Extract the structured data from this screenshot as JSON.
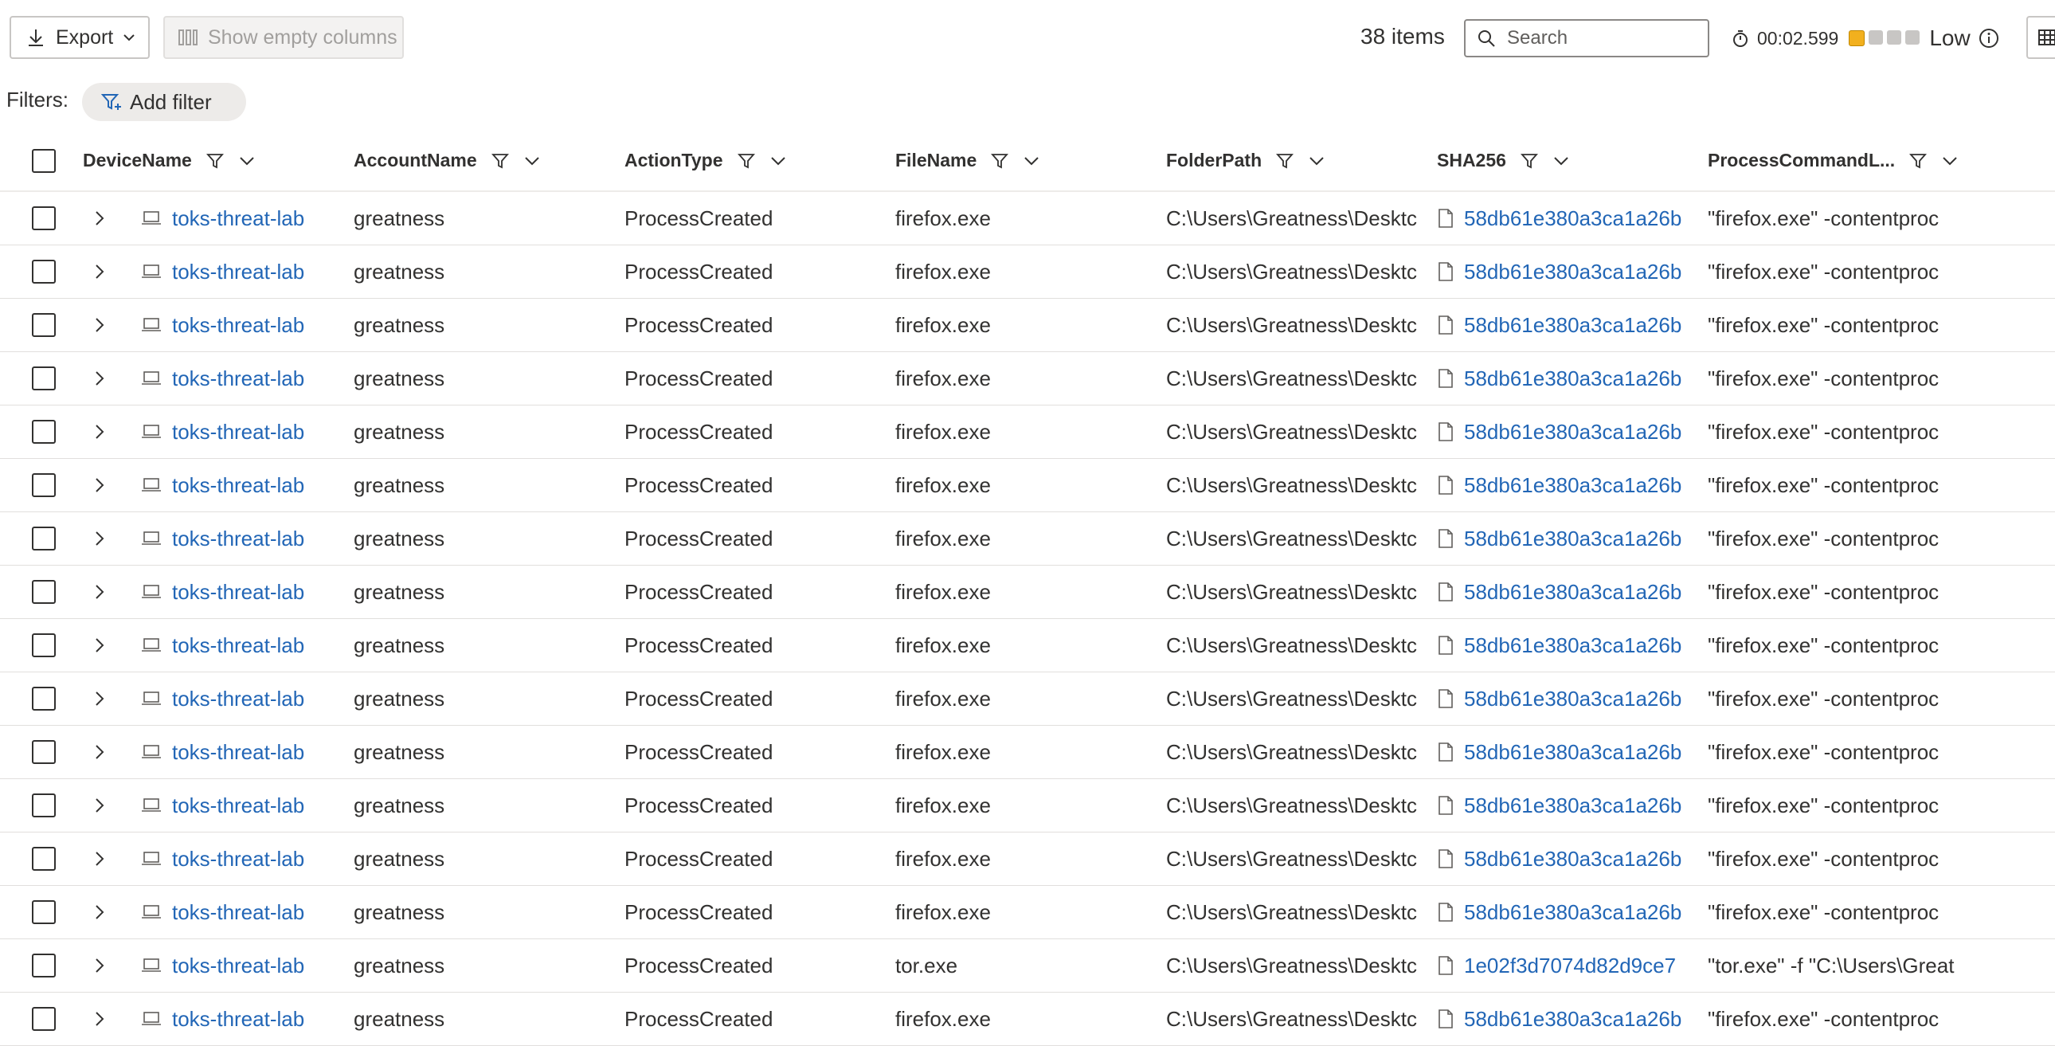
{
  "toolbar": {
    "export_label": "Export",
    "show_empty_label": "Show empty columns",
    "items_count": "38 items",
    "search_placeholder": "Search",
    "timer": "00:02.599",
    "level": "Low",
    "level_colors": [
      "#f2b01e",
      "#c8c6c4",
      "#c8c6c4",
      "#c8c6c4"
    ]
  },
  "filters": {
    "label": "Filters:",
    "add_filter_label": "Add filter"
  },
  "columns": [
    "DeviceName",
    "AccountName",
    "ActionType",
    "FileName",
    "FolderPath",
    "SHA256",
    "ProcessCommandL..."
  ],
  "rows": [
    {
      "device": "toks-threat-lab",
      "account": "greatness",
      "action": "ProcessCreated",
      "file": "firefox.exe",
      "folder": "C:\\Users\\Greatness\\Desktc",
      "sha": "58db61e380a3ca1a26b",
      "cmd": "\"firefox.exe\" -contentproc"
    },
    {
      "device": "toks-threat-lab",
      "account": "greatness",
      "action": "ProcessCreated",
      "file": "firefox.exe",
      "folder": "C:\\Users\\Greatness\\Desktc",
      "sha": "58db61e380a3ca1a26b",
      "cmd": "\"firefox.exe\" -contentproc"
    },
    {
      "device": "toks-threat-lab",
      "account": "greatness",
      "action": "ProcessCreated",
      "file": "firefox.exe",
      "folder": "C:\\Users\\Greatness\\Desktc",
      "sha": "58db61e380a3ca1a26b",
      "cmd": "\"firefox.exe\" -contentproc"
    },
    {
      "device": "toks-threat-lab",
      "account": "greatness",
      "action": "ProcessCreated",
      "file": "firefox.exe",
      "folder": "C:\\Users\\Greatness\\Desktc",
      "sha": "58db61e380a3ca1a26b",
      "cmd": "\"firefox.exe\" -contentproc"
    },
    {
      "device": "toks-threat-lab",
      "account": "greatness",
      "action": "ProcessCreated",
      "file": "firefox.exe",
      "folder": "C:\\Users\\Greatness\\Desktc",
      "sha": "58db61e380a3ca1a26b",
      "cmd": "\"firefox.exe\" -contentproc"
    },
    {
      "device": "toks-threat-lab",
      "account": "greatness",
      "action": "ProcessCreated",
      "file": "firefox.exe",
      "folder": "C:\\Users\\Greatness\\Desktc",
      "sha": "58db61e380a3ca1a26b",
      "cmd": "\"firefox.exe\" -contentproc"
    },
    {
      "device": "toks-threat-lab",
      "account": "greatness",
      "action": "ProcessCreated",
      "file": "firefox.exe",
      "folder": "C:\\Users\\Greatness\\Desktc",
      "sha": "58db61e380a3ca1a26b",
      "cmd": "\"firefox.exe\" -contentproc"
    },
    {
      "device": "toks-threat-lab",
      "account": "greatness",
      "action": "ProcessCreated",
      "file": "firefox.exe",
      "folder": "C:\\Users\\Greatness\\Desktc",
      "sha": "58db61e380a3ca1a26b",
      "cmd": "\"firefox.exe\" -contentproc"
    },
    {
      "device": "toks-threat-lab",
      "account": "greatness",
      "action": "ProcessCreated",
      "file": "firefox.exe",
      "folder": "C:\\Users\\Greatness\\Desktc",
      "sha": "58db61e380a3ca1a26b",
      "cmd": "\"firefox.exe\" -contentproc"
    },
    {
      "device": "toks-threat-lab",
      "account": "greatness",
      "action": "ProcessCreated",
      "file": "firefox.exe",
      "folder": "C:\\Users\\Greatness\\Desktc",
      "sha": "58db61e380a3ca1a26b",
      "cmd": "\"firefox.exe\" -contentproc"
    },
    {
      "device": "toks-threat-lab",
      "account": "greatness",
      "action": "ProcessCreated",
      "file": "firefox.exe",
      "folder": "C:\\Users\\Greatness\\Desktc",
      "sha": "58db61e380a3ca1a26b",
      "cmd": "\"firefox.exe\" -contentproc"
    },
    {
      "device": "toks-threat-lab",
      "account": "greatness",
      "action": "ProcessCreated",
      "file": "firefox.exe",
      "folder": "C:\\Users\\Greatness\\Desktc",
      "sha": "58db61e380a3ca1a26b",
      "cmd": "\"firefox.exe\" -contentproc"
    },
    {
      "device": "toks-threat-lab",
      "account": "greatness",
      "action": "ProcessCreated",
      "file": "firefox.exe",
      "folder": "C:\\Users\\Greatness\\Desktc",
      "sha": "58db61e380a3ca1a26b",
      "cmd": "\"firefox.exe\" -contentproc"
    },
    {
      "device": "toks-threat-lab",
      "account": "greatness",
      "action": "ProcessCreated",
      "file": "firefox.exe",
      "folder": "C:\\Users\\Greatness\\Desktc",
      "sha": "58db61e380a3ca1a26b",
      "cmd": "\"firefox.exe\" -contentproc"
    },
    {
      "device": "toks-threat-lab",
      "account": "greatness",
      "action": "ProcessCreated",
      "file": "tor.exe",
      "folder": "C:\\Users\\Greatness\\Desktc",
      "sha": "1e02f3d7074d82d9ce7",
      "cmd": "\"tor.exe\" -f \"C:\\Users\\Great"
    },
    {
      "device": "toks-threat-lab",
      "account": "greatness",
      "action": "ProcessCreated",
      "file": "firefox.exe",
      "folder": "C:\\Users\\Greatness\\Desktc",
      "sha": "58db61e380a3ca1a26b",
      "cmd": "\"firefox.exe\" -contentproc"
    }
  ]
}
